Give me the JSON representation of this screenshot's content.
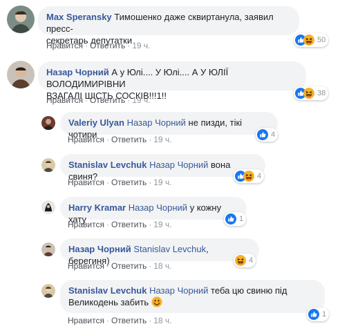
{
  "comments": [
    {
      "author": "Max Speransky",
      "text_lines": [
        "Тимошенко даже сквиртанула, заявил пресс-",
        "секретарь депутатки"
      ],
      "like": "Нравится",
      "reply": "Ответить",
      "time": "19 ч.",
      "reactions": [
        "like",
        "haha"
      ],
      "reaction_count": "50"
    },
    {
      "author": "Назар Чорний",
      "text_lines": [
        "А у Юлі.... У Юлі.... А У ЮЛІЇ ВОЛОДИМИРІВНИ",
        "ВЗАГАЛІ ШІСТЬ СОСКІВ!!!1!!"
      ],
      "like": "Нравится",
      "reply": "Ответить",
      "time": "19 ч.",
      "reactions": [
        "like",
        "haha"
      ],
      "reaction_count": "38"
    }
  ],
  "replies": [
    {
      "author": "Valeriy Ulyan",
      "mention": "Назар Чорний",
      "text": "не пизди, тікі чотири",
      "like": "Нравится",
      "reply": "Ответить",
      "time": "19 ч.",
      "reactions": [
        "like"
      ],
      "reaction_count": "4"
    },
    {
      "author": "Stanislav Levchuk",
      "mention": "Назар Чорний",
      "text": "вона свиня?",
      "like": "Нравится",
      "reply": "Ответить",
      "time": "19 ч.",
      "reactions": [
        "like",
        "haha"
      ],
      "reaction_count": "4"
    },
    {
      "author": "Harry Kramar",
      "mention": "Назар Чорний",
      "text": "у кожну хату",
      "like": "Нравится",
      "reply": "Ответить",
      "time": "19 ч.",
      "reactions": [
        "like"
      ],
      "reaction_count": "1"
    },
    {
      "author": "Назар Чорний",
      "mention": "Stanislav Levchuk",
      "text": ", берегиня)",
      "like": "Нравится",
      "reply": "Ответить",
      "time": "18 ч.",
      "reactions": [
        "haha"
      ],
      "reaction_count": "4"
    },
    {
      "author": "Stanislav Levchuk",
      "mention": "Назар Чорний",
      "text_lines": [
        "теба цю свиню під",
        "Великодень забить"
      ],
      "like": "Нравится",
      "reply": "Ответить",
      "time": "18 ч.",
      "reactions": [
        "like"
      ],
      "reaction_count": "1"
    }
  ],
  "colors": {
    "link": "#385898",
    "bubble": "#f2f3f5",
    "meta": "#90949c",
    "like_blue": "#1877f2",
    "haha_yellow": "#f7b125"
  }
}
